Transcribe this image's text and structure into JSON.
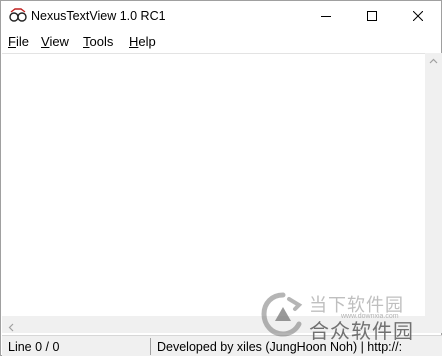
{
  "window": {
    "title": "NexusTextView 1.0 RC1"
  },
  "menu": {
    "file": {
      "accel": "F",
      "rest": "ile"
    },
    "view": {
      "accel": "V",
      "rest": "iew"
    },
    "tools": {
      "accel": "T",
      "rest": "ools"
    },
    "help": {
      "accel": "H",
      "rest": "elp"
    }
  },
  "status": {
    "line": "Line 0 / 0",
    "developer": "Developed by xiles (JungHoon Noh) | http://:"
  },
  "watermark": {
    "top_text": "当下软件园",
    "bottom_text": "合众软件园",
    "url": "www.downxia.com"
  }
}
